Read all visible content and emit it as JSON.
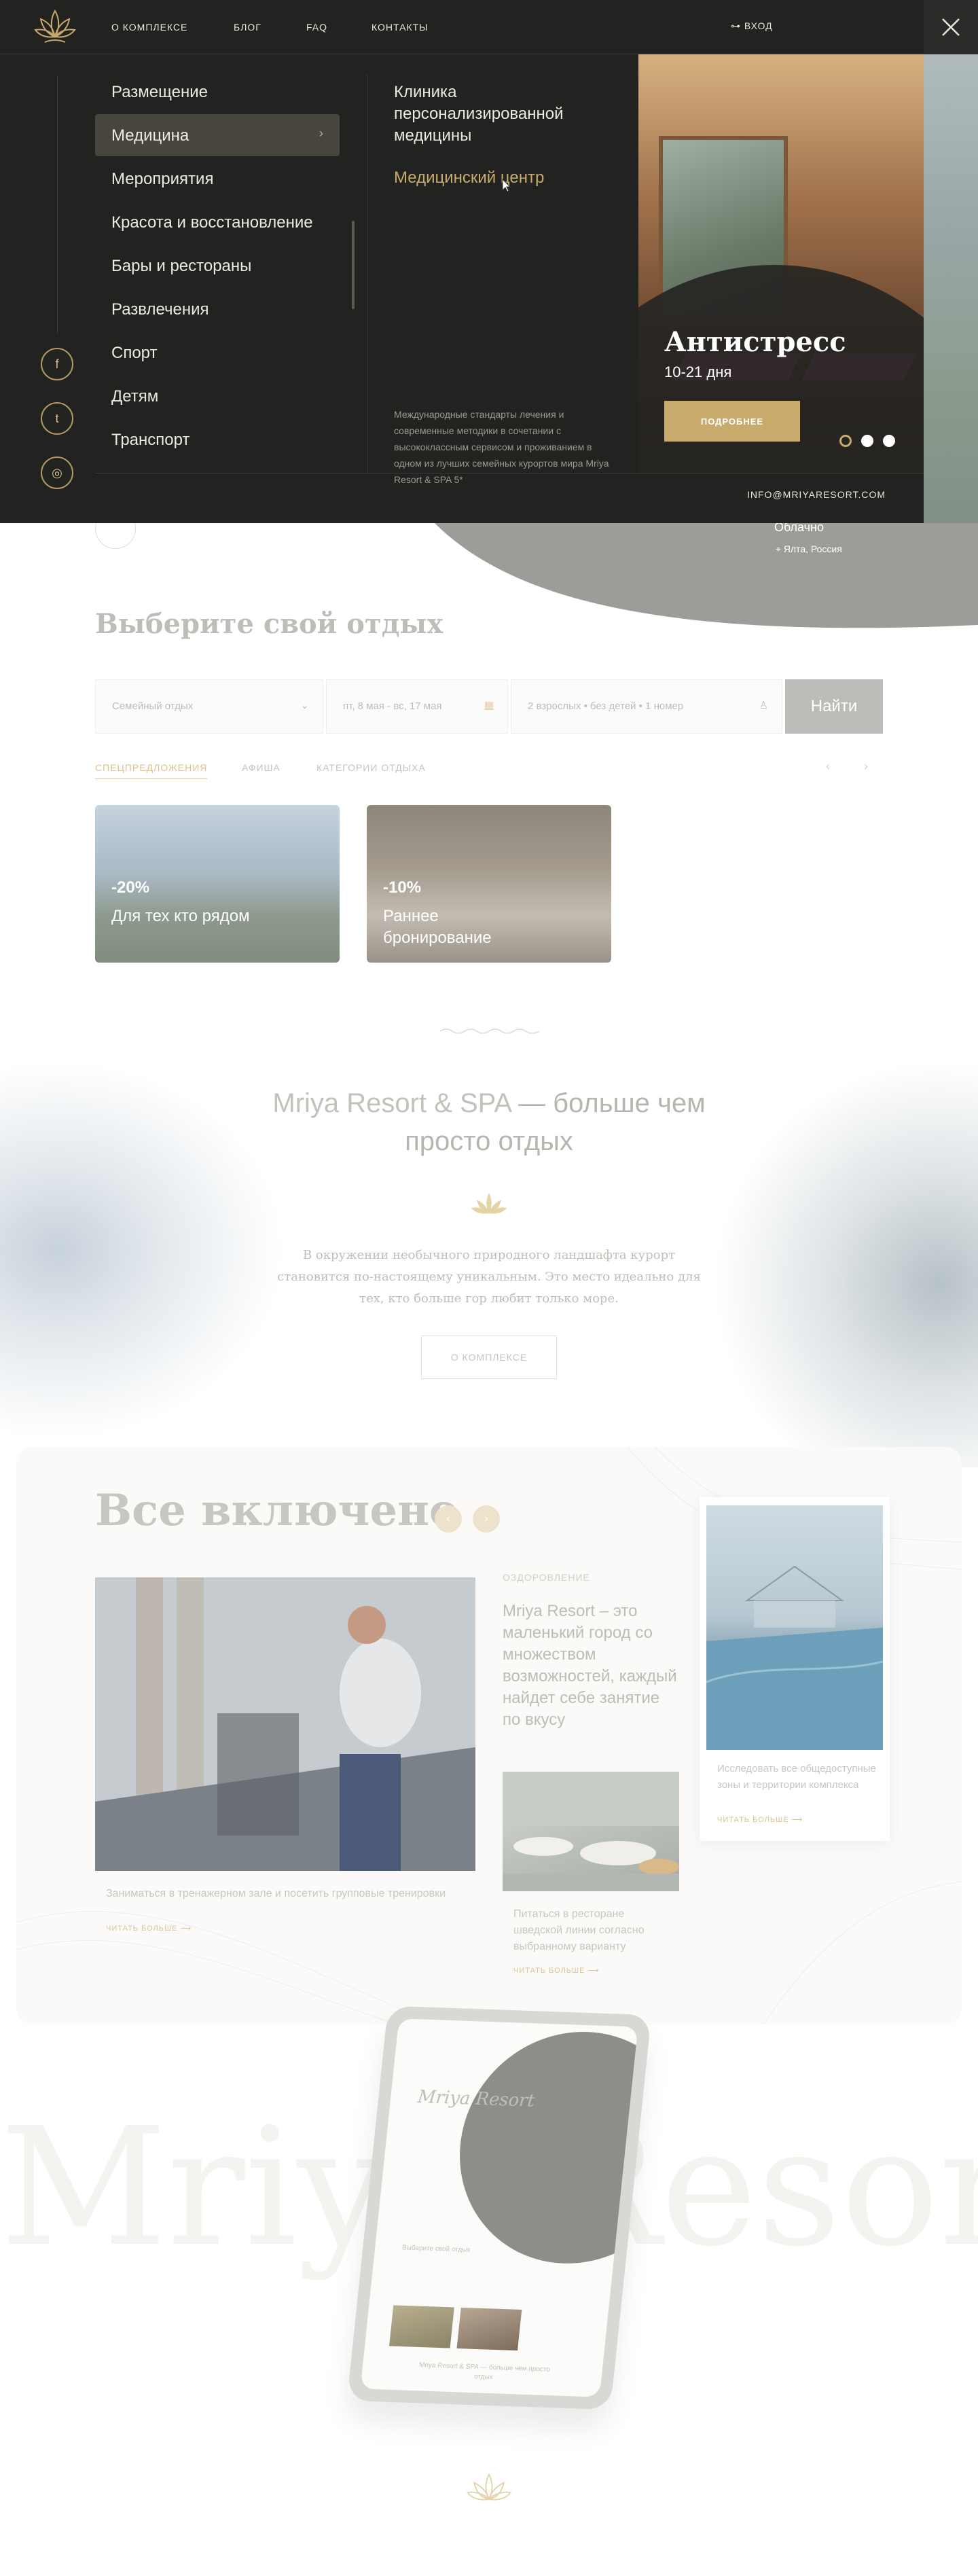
{
  "nav": {
    "links": [
      "О КОМПЛЕКСЕ",
      "БЛОГ",
      "FAQ",
      "КОНТАКТЫ"
    ],
    "login": "ВХОД"
  },
  "menu": {
    "items": [
      "Размещение",
      "Медицина",
      "Мероприятия",
      "Красота и восстановление",
      "Бары и рестораны",
      "Развлечения",
      "Спорт",
      "Детям",
      "Транспорт"
    ],
    "active_index": 1,
    "sub_items": [
      "Клиника персонализированной медицины",
      "Медицинский центр"
    ],
    "description": "Международные стандарты лечения и современные методики в сочетании с высококлассным сервисом и проживанием в одном из лучших семейных курортов мира Mriya Resort & SPA 5*",
    "email": "INFO@MRIYARESORT.COM",
    "promo": {
      "title": "Антистресс",
      "subtitle": "10-21 дня",
      "button": "ПОДРОБНЕЕ"
    },
    "social_icons": [
      "facebook-icon",
      "twitter-icon",
      "instagram-icon"
    ]
  },
  "weather": {
    "condition": "Облачно",
    "location": "Ялта, Россия"
  },
  "booking": {
    "title": "Выберите свой отдых",
    "type_placeholder": "Семейный отдых",
    "dates": "пт, 8 мая - вс, 17 мая",
    "guests": "2 взрослых • без детей • 1 номер",
    "search": "Найти"
  },
  "tabs": [
    "СПЕЦПРЕДЛОЖЕНИЯ",
    "АФИША",
    "КАТЕГОРИИ ОТДЫХА"
  ],
  "offers": [
    {
      "pct": "-20%",
      "text": "Для тех кто рядом"
    },
    {
      "pct": "-10%",
      "text": "Раннее бронирование"
    }
  ],
  "about": {
    "title_part1": "Mriya Resort & SPA",
    "title_part2": "— больше чем просто отдых",
    "text": "В окружении необычного природного ландшафта курорт становится по-настоящему уникальным. Это место идеально для тех, кто больше гор любит только море.",
    "button": "О КОМПЛЕКСЕ"
  },
  "all_inclusive": {
    "title": "Все включено",
    "gym_caption": "Заниматься в тренажерном зале и посетить групповые тренировки",
    "read_more": "читать больше",
    "category": "ОЗДОРОВЛЕНИЕ",
    "headline": "Mriya Resort – это маленький город со множеством возможностей, каждый найдет себе занятие по вкусу",
    "restaurant_caption": "Питаться в ресторане шведской линии согласно выбранному варианту",
    "pool_caption": "Исследовать все общедоступные зоны и территории комплекса"
  },
  "footer": {
    "watermark": "Mriya Resort",
    "tablet_title": "Mriya Resort",
    "tablet_sub": "Выберите свой отдых",
    "tablet_footer": "Mriya Resort & SPA — больше чем просто отдых"
  },
  "colors": {
    "gold": "#C9AA6D",
    "dark": "#222220"
  }
}
